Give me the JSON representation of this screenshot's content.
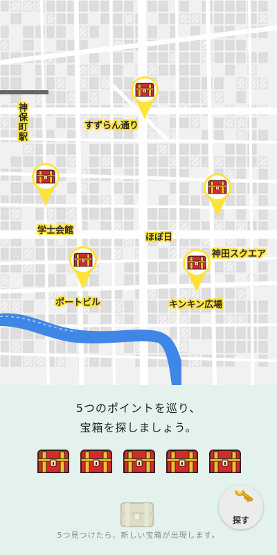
{
  "map": {
    "pins": [
      {
        "id": "suzuran"
      },
      {
        "id": "gakushikaikan"
      },
      {
        "id": "hobonichi"
      },
      {
        "id": "port-building"
      },
      {
        "id": "kinkin"
      }
    ],
    "labels": {
      "jimbocho_station": "神保町駅",
      "suzuran_dori": "すずらん通り",
      "gakushikaikan": "学士会館",
      "hobonichi": "ほぼ日",
      "kanda_square": "神田スクエア",
      "port_building": "ポートビル",
      "kinkin_hiroba": "キンキン広場"
    }
  },
  "panel": {
    "message_line1": "5つのポイントを巡り、",
    "message_line2": "宝箱を探しましょう。",
    "chest_count": 5,
    "hint": "5つ見つけたら、新しい宝箱が出現します。",
    "search_label": "探す"
  },
  "colors": {
    "pin_yellow": "#ffe23a",
    "chest_red": "#d42a2f",
    "chest_gold": "#f2c12e",
    "panel_bg": "#e3f2ec",
    "river": "#3f87e6"
  }
}
